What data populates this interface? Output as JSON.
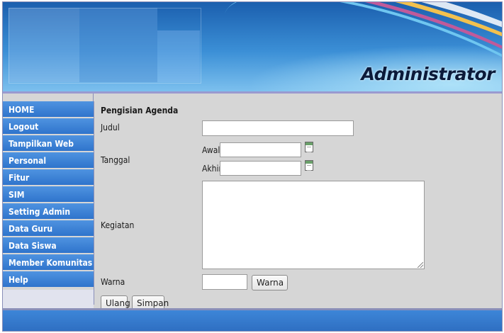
{
  "header": {
    "title": "Administrator"
  },
  "sidebar": {
    "items": [
      {
        "label": "HOME",
        "name": "sidebar-item-home"
      },
      {
        "label": "Logout",
        "name": "sidebar-item-logout"
      },
      {
        "label": "Tampilkan Web",
        "name": "sidebar-item-tampilkan-web"
      },
      {
        "label": "Personal",
        "name": "sidebar-item-personal"
      },
      {
        "label": "Fitur",
        "name": "sidebar-item-fitur"
      },
      {
        "label": "SIM",
        "name": "sidebar-item-sim"
      },
      {
        "label": "Setting Admin",
        "name": "sidebar-item-setting-admin"
      },
      {
        "label": "Data Guru",
        "name": "sidebar-item-data-guru"
      },
      {
        "label": "Data Siswa",
        "name": "sidebar-item-data-siswa"
      },
      {
        "label": "Member Komunitas",
        "name": "sidebar-item-member-komunitas"
      },
      {
        "label": "Help",
        "name": "sidebar-item-help"
      }
    ]
  },
  "form": {
    "heading": "Pengisian Agenda",
    "judul_label": "Judul",
    "judul_value": "",
    "tanggal_label": "Tanggal",
    "awal_label": "Awal",
    "awal_value": "",
    "akhir_label": "Akhir",
    "akhir_value": "",
    "kegiatan_label": "Kegiatan",
    "kegiatan_value": "",
    "warna_label": "Warna",
    "warna_value": "",
    "warna_button": "Warna",
    "ulang_button": "Ulang",
    "simpan_button": "Simpan"
  },
  "icons": {
    "calendar": "calendar-icon"
  },
  "colors": {
    "nav_blue": "#3a80d6",
    "content_bg": "#d6d6d6",
    "border": "#8a8fb8"
  }
}
